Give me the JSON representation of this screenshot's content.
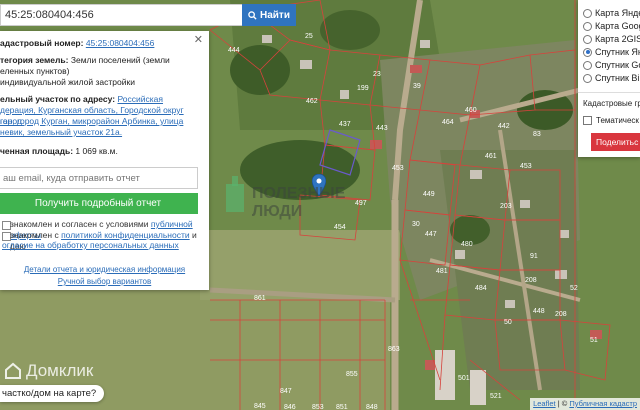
{
  "search": {
    "value": "45:25:080404:456",
    "button_label": "Найти"
  },
  "info": {
    "cadastral_label": "адастровый номер:",
    "cadastral_value": "45:25:080404:456",
    "category_label": "тегория земель:",
    "category_value": "Земли поселений (земли",
    "category_line2": "еленных пунктов)",
    "usage_line": "индивидуальной жилой застройки",
    "address_label": "ельный участок по адресу:",
    "address_link_1": "Российская",
    "address_line_2": "дерация, Курганская область, Городской округ город",
    "address_line_3": "ган, город Курган, микрорайон Арбинка, улица",
    "address_line_4": "невик, земельный участок 21а.",
    "area_label": "ченная площадь:",
    "area_value": "1 069 кв.м.",
    "email_placeholder": "аш email, куда отправить отчет",
    "report_button": "Получить подробный отчет",
    "consent_1a": "знакомлен и согласен с условиями",
    "consent_1b": "публичной оферты",
    "consent_2a": "знакомлен с",
    "consent_2b": "политикой конфиденциальности",
    "consent_2c": "и даю",
    "consent_3": "огласие на обработку персональных данных",
    "details_link": "Детали отчета и юридическая информация",
    "manual_link": "Ручной выбор вариантов"
  },
  "layers": {
    "items": [
      {
        "label": "Карта Янде",
        "selected": false
      },
      {
        "label": "Карта Goog",
        "selected": false
      },
      {
        "label": "Карта 2GIS",
        "selected": false
      },
      {
        "label": "Спутник Ян",
        "selected": true
      },
      {
        "label": "Спутник Go",
        "selected": false
      },
      {
        "label": "Спутник Bi",
        "selected": false
      }
    ],
    "cadastral_title": "Кадастровые гра",
    "thematic_label": "Тематическ",
    "share_button": "Поделитьс"
  },
  "watermark": {
    "line1": "ПОЛЕЗНЫЕ",
    "line2": "ЛЮДИ"
  },
  "domclick": "Домклик",
  "bottom_question": "частко/дом на карте?",
  "attribution": {
    "leaflet": "Leaflet",
    "separator": " | © ",
    "pkk": "Публичная кадастр"
  },
  "map": {
    "parcel_numbers": [
      "444",
      "462",
      "199",
      "443",
      "437",
      "460",
      "464",
      "461",
      "83",
      "453",
      "449",
      "453",
      "442",
      "447",
      "203",
      "208",
      "481",
      "480",
      "454",
      "497",
      "484",
      "861",
      "208",
      "51",
      "52",
      "30",
      "448",
      "91",
      "50",
      "847",
      "845",
      "855",
      "863",
      "846",
      "853",
      "851",
      "848",
      "521",
      "501",
      "23",
      "25",
      "39"
    ],
    "colors": {
      "parcel_line": "#d6433c",
      "grass": "#6f8a4a",
      "field": "#9aa56a",
      "road": "#b9ab8e"
    }
  }
}
